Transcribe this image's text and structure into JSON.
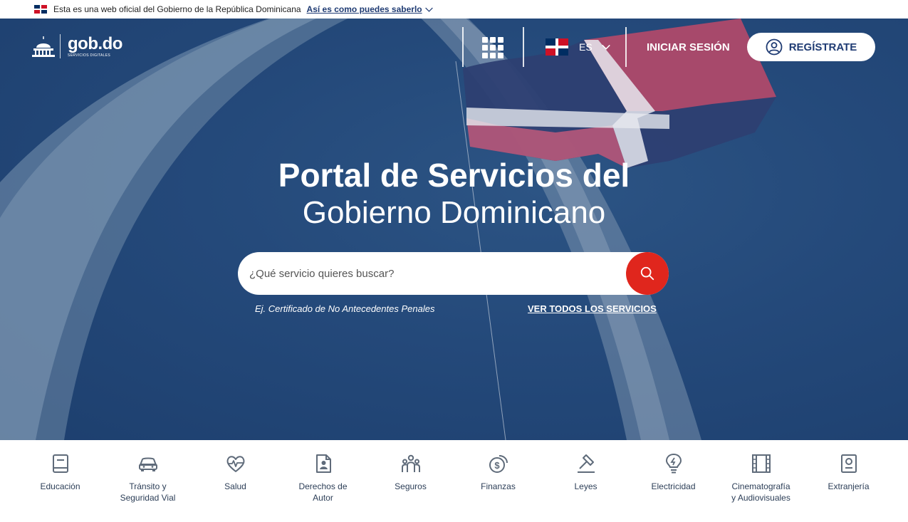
{
  "official_bar": {
    "text": "Esta es una web oficial del Gobierno de la República Dominicana",
    "link": "Así es como puedes saberlo",
    "link_icon": "chevron-down-icon"
  },
  "header": {
    "logo_main": "gob.do",
    "logo_sub": "SERVICIOS DIGITALES",
    "apps_icon": "grid-icon",
    "language": "ES",
    "login": "INICIAR SESIÓN",
    "register": "REGÍSTRATE",
    "register_icon": "user-circle-icon"
  },
  "hero": {
    "title": "Portal de Servicios del",
    "subtitle": "Gobierno Dominicano"
  },
  "search": {
    "placeholder": "¿Qué servicio quieres buscar?",
    "example": "Ej. Certificado de No Antecedentes Penales",
    "all_services": "VER TODOS LOS SERVICIOS",
    "icon": "search-icon"
  },
  "categories": [
    {
      "label": "Educación",
      "icon": "book-icon"
    },
    {
      "label": "Tránsito y Seguridad Vial",
      "icon": "car-icon"
    },
    {
      "label": "Salud",
      "icon": "heart-pulse-icon"
    },
    {
      "label": "Derechos de Autor",
      "icon": "document-person-icon"
    },
    {
      "label": "Seguros",
      "icon": "people-icon"
    },
    {
      "label": "Finanzas",
      "icon": "coins-icon"
    },
    {
      "label": "Leyes",
      "icon": "gavel-icon"
    },
    {
      "label": "Electricidad",
      "icon": "lightbulb-icon"
    },
    {
      "label": "Cinematografía y Audiovisuales",
      "icon": "film-icon"
    },
    {
      "label": "Extranjería",
      "icon": "passport-icon"
    }
  ],
  "colors": {
    "primary": "#1f3b73",
    "accent": "#e0261d",
    "flag_blue": "#002d62",
    "flag_red": "#ce1126"
  }
}
